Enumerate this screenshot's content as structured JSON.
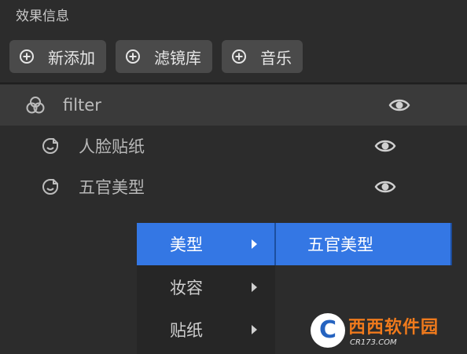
{
  "panel": {
    "title": "效果信息"
  },
  "toolbar": {
    "buttons": [
      {
        "label": "新添加",
        "icon": "plus-circle-icon"
      },
      {
        "label": "滤镜库",
        "icon": "plus-circle-icon"
      },
      {
        "label": "音乐",
        "icon": "plus-circle-icon"
      }
    ]
  },
  "tree": {
    "parent": {
      "label": "filter",
      "icon": "filter-circles-icon",
      "visible": true
    },
    "children": [
      {
        "label": "人脸贴纸",
        "icon": "face-sticker-icon",
        "visible": true
      },
      {
        "label": "五官美型",
        "icon": "face-sticker-icon",
        "visible": true
      }
    ]
  },
  "context_menu": {
    "items": [
      {
        "label": "美型",
        "active": true
      },
      {
        "label": "妆容",
        "active": false
      },
      {
        "label": "贴纸",
        "active": false
      }
    ],
    "submenu": {
      "label": "五官美型"
    }
  },
  "watermark": {
    "brand": "西西软件园",
    "sub": "CR173.COM",
    "letter": "C"
  },
  "colors": {
    "background": "#2c2c2c",
    "highlight": "#3477e4",
    "button": "#4a4a4a"
  }
}
